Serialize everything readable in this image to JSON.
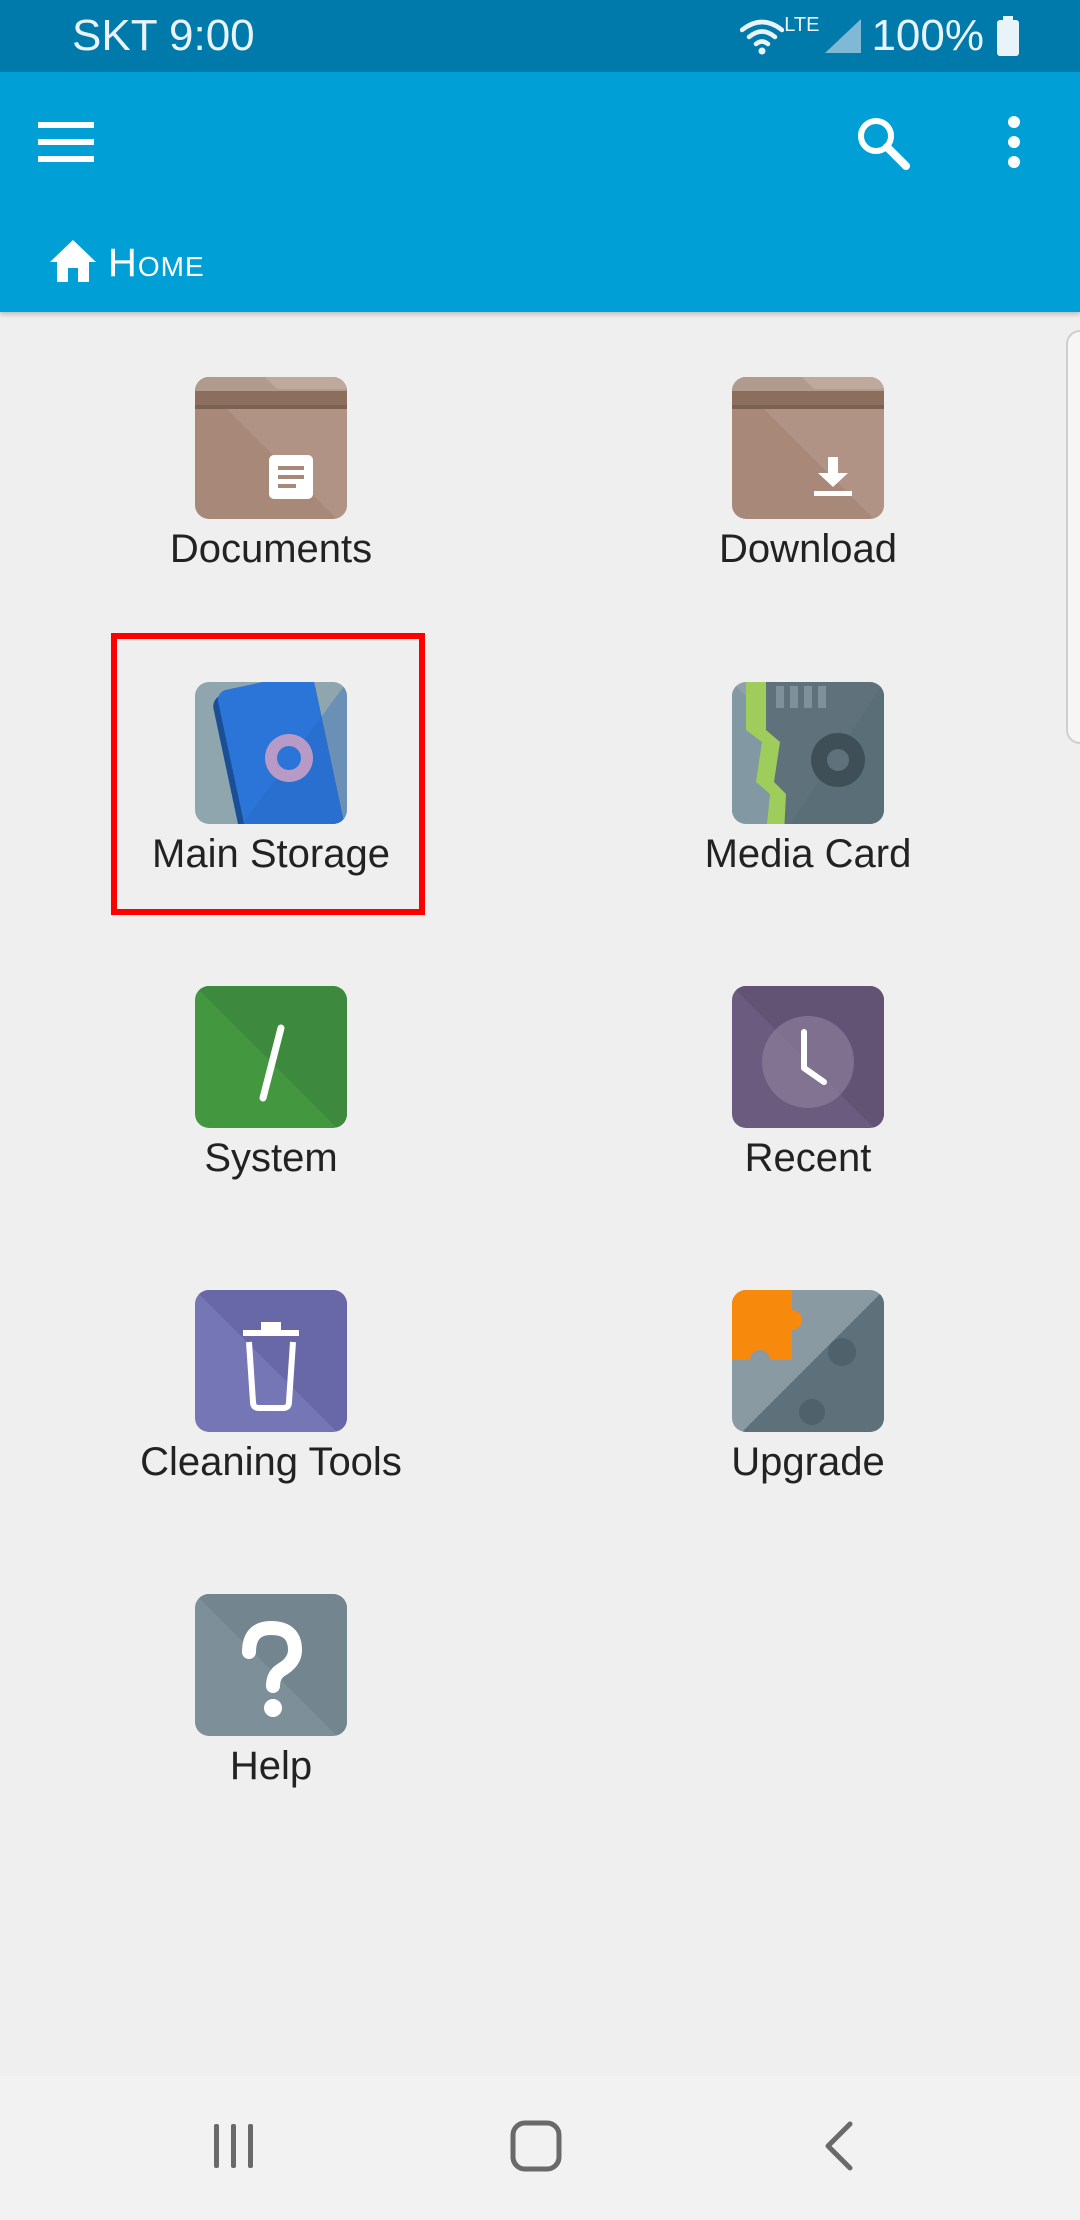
{
  "status_bar": {
    "carrier_time": "SKT 9:00",
    "network": "LTE",
    "battery": "100%",
    "icons": [
      "wifi-icon",
      "signal-icon",
      "battery-icon"
    ]
  },
  "toolbar": {
    "menu_icon": "menu-icon",
    "search_icon": "search-icon",
    "more_icon": "more-vert-icon",
    "breadcrumb_icon": "home-icon",
    "breadcrumb_label": "Home",
    "color": "#009fd6"
  },
  "tiles": [
    {
      "label": "Documents",
      "icon": "documents-folder-icon"
    },
    {
      "label": "Download",
      "icon": "download-folder-icon"
    },
    {
      "label": "Main Storage",
      "icon": "main-storage-icon"
    },
    {
      "label": "Media Card",
      "icon": "media-card-icon"
    },
    {
      "label": "System",
      "icon": "system-icon"
    },
    {
      "label": "Recent",
      "icon": "recent-clock-icon"
    },
    {
      "label": "Cleaning Tools",
      "icon": "trash-icon"
    },
    {
      "label": "Upgrade",
      "icon": "puzzle-icon"
    },
    {
      "label": "Help",
      "icon": "help-icon"
    }
  ],
  "highlight_color": "#ff0000",
  "nav_bar": {
    "icons": [
      "recents-icon",
      "home-nav-icon",
      "back-icon"
    ]
  }
}
